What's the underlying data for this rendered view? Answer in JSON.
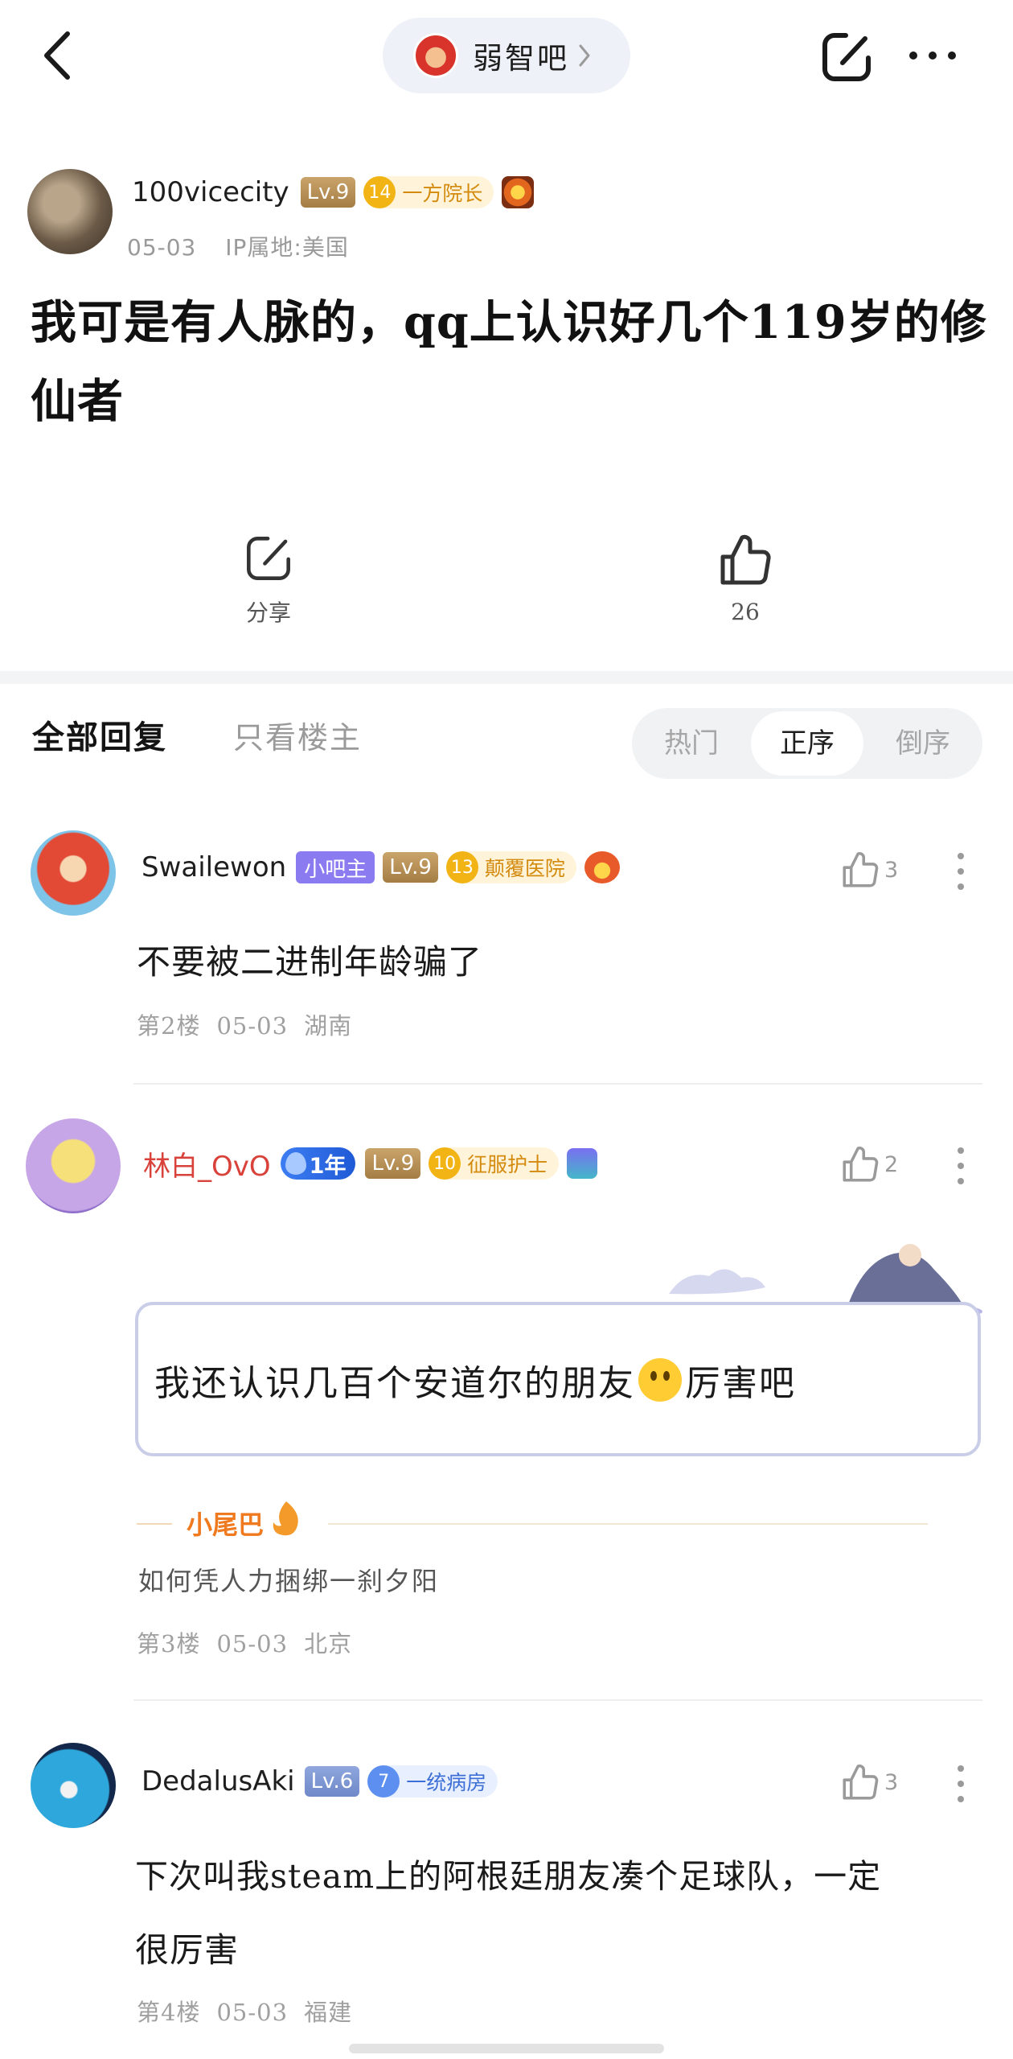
{
  "topbar": {
    "forum_name": "弱智吧",
    "back_icon": "chevron-left-icon",
    "share_icon": "share-icon",
    "more_icon": "more-dots-icon"
  },
  "post": {
    "author": {
      "name": "100vicecity",
      "level": "Lv.9",
      "title_num": "14",
      "title_text": "一方院长"
    },
    "date": "05-03",
    "ip": "IP属地:美国",
    "title": "我可是有人脉的，qq上认识好几个119岁的修仙者",
    "share_label": "分享",
    "like_count": "26"
  },
  "tabs": {
    "all": "全部回复",
    "op_only": "只看楼主",
    "sort": [
      "热门",
      "正序",
      "倒序"
    ],
    "sort_selected": "正序"
  },
  "replies": [
    {
      "name": "Swailewon",
      "mod_tag": "小吧主",
      "level": "Lv.9",
      "title_num": "13",
      "title_text": "颠覆医院",
      "likes": "3",
      "text": "不要被二进制年龄骗了",
      "floor": "第2楼",
      "date": "05-03",
      "location": "湖南"
    },
    {
      "name": "林白_OvO",
      "year_tag": "1年",
      "level": "Lv.9",
      "title_num": "10",
      "title_text": "征服护士",
      "likes": "2",
      "text_before": "我还认识几百个安道尔的朋友",
      "text_after": "厉害吧",
      "tail_label": "小尾巴",
      "tail_sig": "如何凭人力捆绑一刹夕阳",
      "floor": "第3楼",
      "date": "05-03",
      "location": "北京"
    },
    {
      "name": "DedalusAki",
      "level": "Lv.6",
      "title_num": "7",
      "title_text": "一统病房",
      "likes": "3",
      "text_line1": "下次叫我steam上的阿根廷朋友凑个足球队，一定",
      "text_line2": "很厉害",
      "floor": "第4楼",
      "date": "05-03",
      "location": "福建"
    }
  ],
  "colors": {
    "accent_red": "#d9423a",
    "gold_badge": "#f2b415",
    "mod_purple": "#8a7cf0",
    "tail_orange": "#f07a1f"
  }
}
